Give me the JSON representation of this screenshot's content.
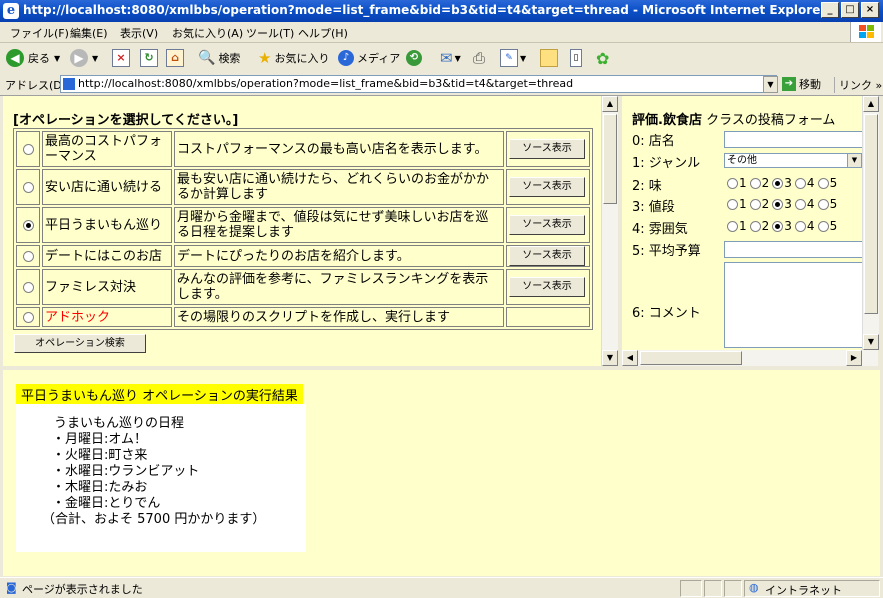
{
  "window": {
    "title": "http://localhost:8080/xmlbbs/operation?mode=list_frame&bid=b3&tid=t4&target=thread - Microsoft Internet Explorer"
  },
  "menu": {
    "items": [
      "ファイル(F)",
      "編集(E)",
      "表示(V)",
      "お気に入り(A)",
      "ツール(T)",
      "ヘルプ(H)"
    ]
  },
  "toolbar": {
    "back": "戻る",
    "search": "検索",
    "favorites": "お気に入り",
    "media": "メディア"
  },
  "address": {
    "label": "アドレス(D)",
    "url": "http://localhost:8080/xmlbbs/operation?mode=list_frame&bid=b3&tid=t4&target=thread",
    "go": "移動",
    "links": "リンク"
  },
  "operations": {
    "heading": "[オペレーションを選択してください。]",
    "source_label": "ソース表示",
    "search_button": "オペレーション検索",
    "rows": [
      {
        "name": "最高のコストパフォーマンス",
        "desc": "コストパフォーマンスの最も高い店名を表示します。",
        "selected": false
      },
      {
        "name": "安い店に通い続ける",
        "desc": "最も安い店に通い続けたら、どれくらいのお金がかかるか計算します",
        "selected": false
      },
      {
        "name": "平日うまいもん巡り",
        "desc": "月曜から金曜まで、値段は気にせず美味しいお店を巡る日程を提案します",
        "selected": true
      },
      {
        "name": "デートにはこのお店",
        "desc": "デートにぴったりのお店を紹介します。",
        "selected": false
      },
      {
        "name": "ファミレス対決",
        "desc": "みんなの評価を参考に、ファミレスランキングを表示します。",
        "selected": false
      },
      {
        "name": "アドホック",
        "desc": "その場限りのスクリプトを作成し、実行します",
        "selected": false
      }
    ],
    "adhoc_color": "#ff0000"
  },
  "form": {
    "title_bold": "評価.飲食店",
    "title_rest": " クラスの投稿フォーム",
    "fields": {
      "f0": "0:  店名",
      "f1": "1:  ジャンル",
      "f2": "2:  味",
      "f3": "3:  値段",
      "f4": "4:  雰囲気",
      "f5": "5:  平均予算",
      "f6": "6:  コメント"
    },
    "genre_value": "その他",
    "rating_options": [
      "1",
      "2",
      "3",
      "4",
      "5"
    ],
    "rating_selected": "3"
  },
  "result": {
    "heading": "平日うまいもん巡り オペレーションの実行結果",
    "lines": [
      "うまいもん巡りの日程",
      "・月曜日:オム！",
      "・火曜日:町さ来",
      "・水曜日:ウランビアット",
      "・木曜日:たみお",
      "・金曜日:とりでん",
      "（合計、およそ 5700 円かかります）"
    ]
  },
  "status": {
    "text": "ページが表示されました",
    "zone": "イントラネット"
  },
  "colors": {
    "frame_bg": "#ffffcc",
    "title_blue": "#0a4fc6",
    "highlight": "#ffff00"
  }
}
